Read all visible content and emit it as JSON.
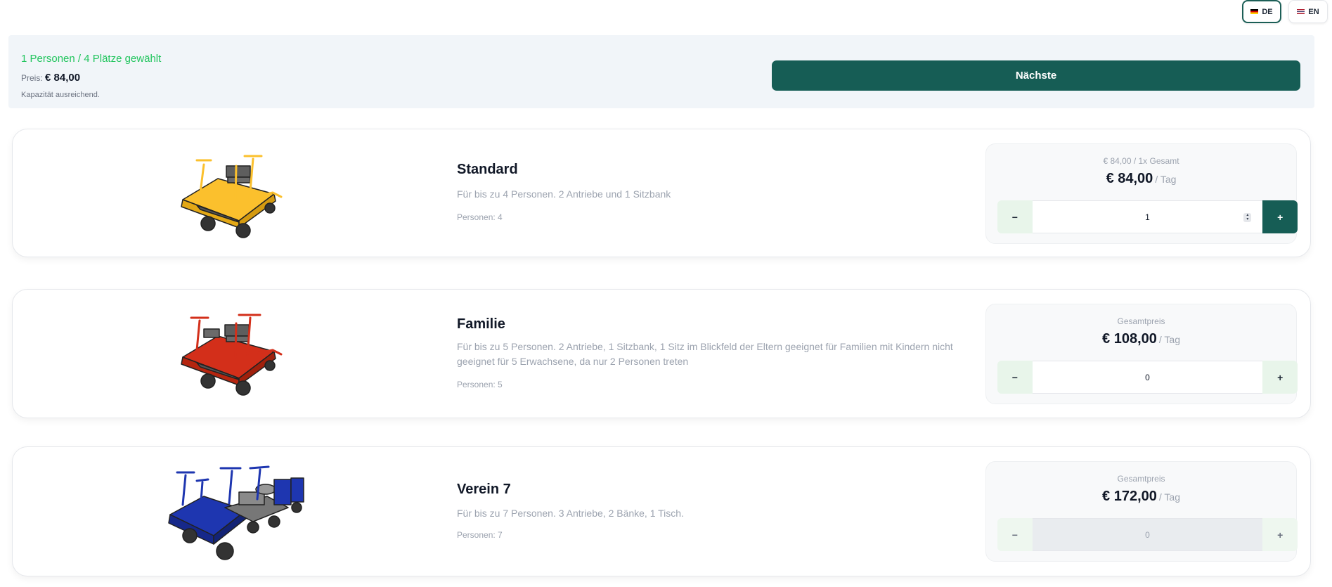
{
  "languages": [
    {
      "code": "DE",
      "active": true
    },
    {
      "code": "EN",
      "active": false
    }
  ],
  "summary": {
    "selected_text": "1 Personen / 4 Plätze gewählt",
    "price_label": "Preis:",
    "price_value": "€ 84,00",
    "capacity_text": "Kapazität ausreichend.",
    "next_label": "Nächste"
  },
  "products": [
    {
      "title": "Standard",
      "description": "Für bis zu 4 Personen. 2 Antriebe und 1 Sitzbank",
      "persons": "Personen: 4",
      "price_label": "€ 84,00 / 1x Gesamt",
      "price": "€ 84,00",
      "per_day": "/ Tag",
      "quantity": "1",
      "color": "#fbc02d"
    },
    {
      "title": "Familie",
      "description": "Für bis zu 5 Personen. 2 Antriebe, 1 Sitzbank, 1 Sitz im Blickfeld der Eltern geeignet für Familien mit Kindern nicht geeignet für 5 Erwachsene, da nur 2 Personen treten",
      "persons": "Personen: 5",
      "price_label": "Gesamtpreis",
      "price": "€ 108,00",
      "per_day": "/ Tag",
      "quantity": "0",
      "color": "#d32f1a"
    },
    {
      "title": "Verein 7",
      "description": "Für bis zu 7 Personen. 3 Antriebe, 2 Bänke, 1 Tisch.",
      "persons": "Personen: 7",
      "price_label": "Gesamtpreis",
      "price": "€ 172,00",
      "per_day": "/ Tag",
      "quantity": "0",
      "color": "#1e36b0"
    }
  ],
  "stepper": {
    "minus": "−",
    "plus": "+"
  },
  "colors": {
    "accent": "#165d55",
    "success": "#22c55e",
    "summary_bg": "#f1f5f9"
  }
}
